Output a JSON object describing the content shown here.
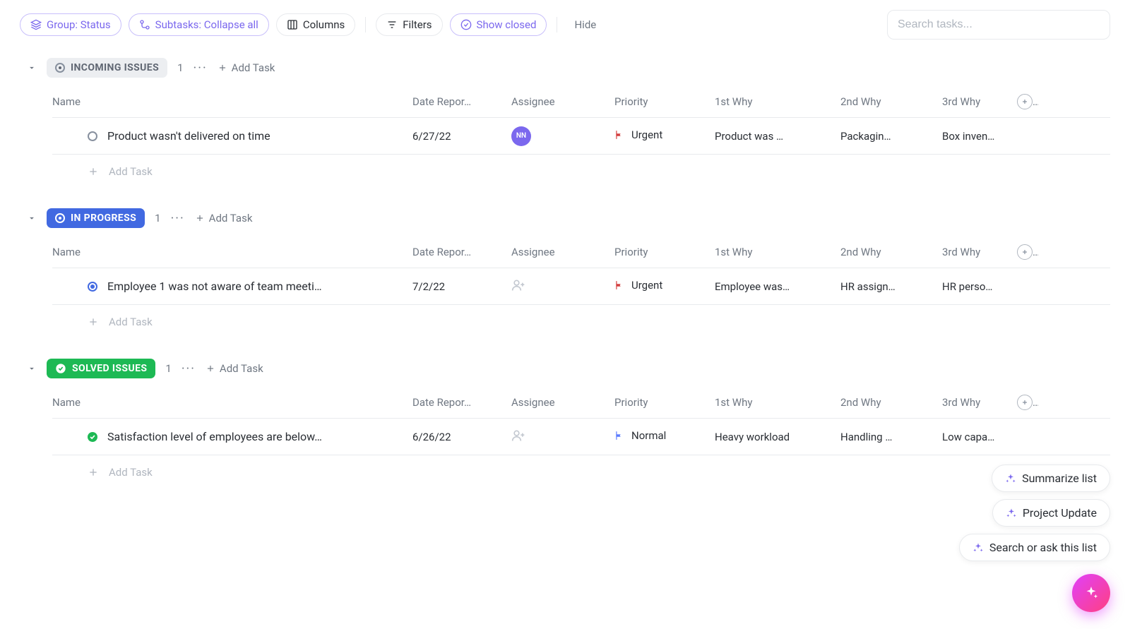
{
  "toolbar": {
    "group_label": "Group: Status",
    "subtasks_label": "Subtasks: Collapse all",
    "columns_label": "Columns",
    "filters_label": "Filters",
    "show_closed_label": "Show closed",
    "hide_label": "Hide",
    "search_placeholder": "Search tasks..."
  },
  "columns": {
    "name": "Name",
    "date": "Date Repor…",
    "assignee": "Assignee",
    "priority": "Priority",
    "why1": "1st Why",
    "why2": "2nd Why",
    "why3": "3rd Why"
  },
  "add_task_label": "Add Task",
  "groups": [
    {
      "key": "incoming",
      "title": "INCOMING ISSUES",
      "style": "gray",
      "count": "1",
      "tasks": [
        {
          "name": "Product wasn't delivered on time",
          "date": "6/27/22",
          "assignee_initials": "NN",
          "priority_label": "Urgent",
          "priority_color": "red",
          "why1": "Product was …",
          "why2": "Packagin…",
          "why3": "Box inven…"
        }
      ]
    },
    {
      "key": "inprogress",
      "title": "IN PROGRESS",
      "style": "blue",
      "count": "1",
      "tasks": [
        {
          "name": "Employee 1 was not aware of team meeti…",
          "date": "7/2/22",
          "assignee_initials": "",
          "priority_label": "Urgent",
          "priority_color": "red",
          "why1": "Employee was…",
          "why2": "HR assign…",
          "why3": "HR perso…"
        }
      ]
    },
    {
      "key": "solved",
      "title": "SOLVED ISSUES",
      "style": "green",
      "count": "1",
      "tasks": [
        {
          "name": "Satisfaction level of employees are below…",
          "date": "6/26/22",
          "assignee_initials": "",
          "priority_label": "Normal",
          "priority_color": "blue",
          "why1": "Heavy workload",
          "why2": "Handling …",
          "why3": "Low capa…"
        }
      ]
    }
  ],
  "ai_actions": {
    "summarize": "Summarize list",
    "project_update": "Project Update",
    "search_ask": "Search or ask this list"
  }
}
